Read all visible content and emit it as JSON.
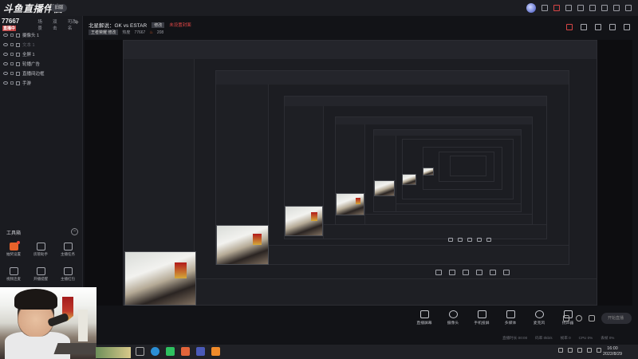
{
  "app": {
    "logo_text": "斗鱼直播伴侣",
    "version_label": "旧版",
    "room_label": "房间号",
    "room_id": "77667",
    "room_id_tag": "直播中"
  },
  "sidebar": {
    "tabs": [
      "场景",
      "双击",
      "可改名"
    ],
    "layers": [
      {
        "label": "摄像头 1",
        "dim": false
      },
      {
        "label": "文本 1",
        "dim": true
      },
      {
        "label": "全屏 1",
        "dim": false
      },
      {
        "label": "轮播广告",
        "dim": false
      },
      {
        "label": "直播间边框",
        "dim": false
      },
      {
        "label": "手游",
        "dim": false
      }
    ],
    "toolbox_title": "工具箱",
    "toolbox_toggle": "−",
    "tools": [
      {
        "label": "抽奖设置",
        "orange": true,
        "badge": true
      },
      {
        "label": "房管助手",
        "orange": false,
        "badge": false
      },
      {
        "label": "主播任务",
        "orange": false,
        "badge": false
      },
      {
        "label": "视频连麦",
        "orange": false,
        "badge": false
      },
      {
        "label": "开播提醒",
        "orange": false,
        "badge": false
      },
      {
        "label": "主播红包",
        "orange": false,
        "badge": false
      }
    ]
  },
  "header": {
    "title": "北星解说：GK vs ESTAR",
    "edit_label": "修改",
    "warning": "未设置封面",
    "category": "王者荣耀",
    "category_tag": "修改",
    "viewers_label": "热度",
    "viewers": "77667",
    "fans": "208"
  },
  "controls": [
    {
      "label": "直播屏幕",
      "round": false
    },
    {
      "label": "摄像头",
      "round": true
    },
    {
      "label": "手机投屏",
      "round": false
    },
    {
      "label": "多媒体",
      "round": false
    },
    {
      "label": "麦克风",
      "round": true
    },
    {
      "label": "扬声器",
      "round": false
    }
  ],
  "live_button": "开始直播",
  "status": [
    "直播时长 00:00",
    "码率 0kb/s",
    "帧率 0",
    "CPU 0%",
    "丢帧 0%"
  ],
  "clock": {
    "time": "16:00",
    "date": "2022/8/29"
  },
  "colors": {
    "accent": "#e8622a",
    "warning": "#e04646",
    "background": "#121317"
  }
}
